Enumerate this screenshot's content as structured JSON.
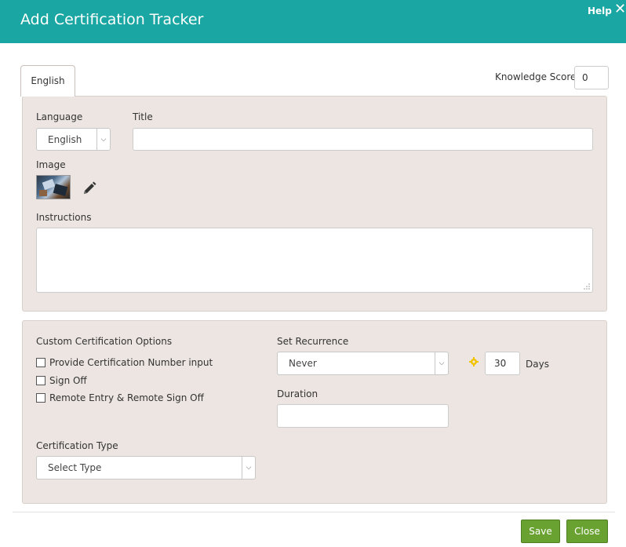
{
  "header": {
    "title": "Add Certification Tracker",
    "help_label": "Help",
    "close_icon": "close-icon",
    "background_color": "#1aa6a2"
  },
  "tabs": [
    {
      "label": "English",
      "active": true
    }
  ],
  "knowledge_score": {
    "label": "Knowledge Score",
    "value": "0"
  },
  "general": {
    "language_label": "Language",
    "language_value": "English",
    "title_label": "Title",
    "title_value": "",
    "image_label": "Image",
    "edit_icon": "pencil-icon",
    "instructions_label": "Instructions",
    "instructions_value": ""
  },
  "options": {
    "custom_label": "Custom Certification Options",
    "checkboxes": [
      {
        "label": "Provide Certification Number input",
        "checked": false
      },
      {
        "label": "Sign Off",
        "checked": false
      },
      {
        "label": "Remote Entry & Remote Sign Off",
        "checked": false
      }
    ],
    "certification_type_label": "Certification Type",
    "certification_type_value": "Select Type",
    "recurrence_label": "Set Recurrence",
    "recurrence_value": "Never",
    "recurrence_days": "30",
    "days_label": "Days",
    "duration_label": "Duration",
    "duration_value": ""
  },
  "footer": {
    "save_label": "Save",
    "close_label": "Close",
    "button_color": "#6aa232"
  }
}
